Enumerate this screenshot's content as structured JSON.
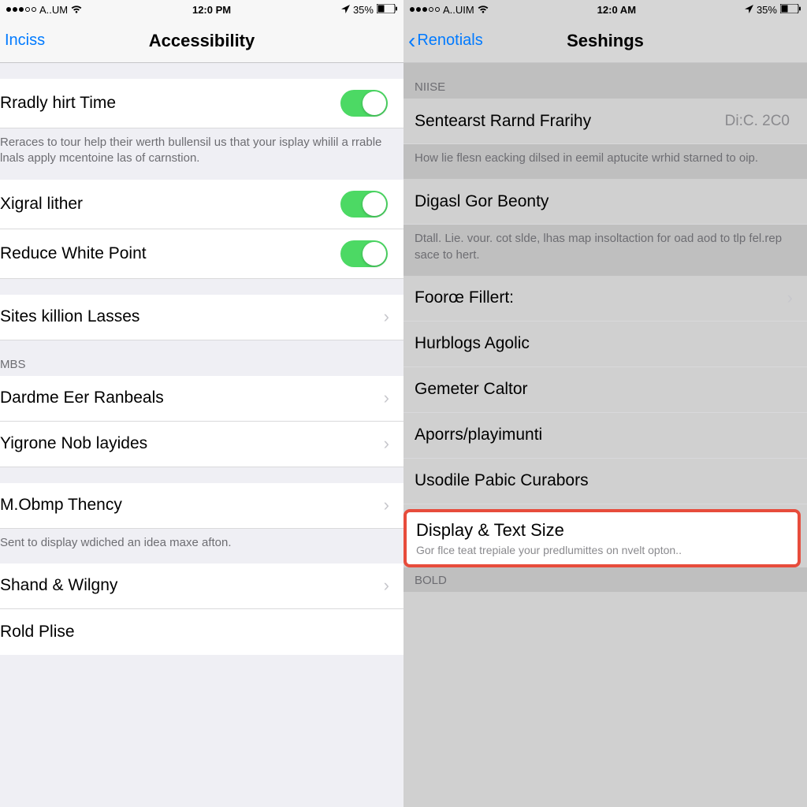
{
  "left": {
    "status": {
      "carrier": "A..UM",
      "time": "12:0 PM",
      "battery": "35%"
    },
    "nav": {
      "back": "Inciss",
      "title": "Accessibility"
    },
    "group1": {
      "toggle1": "Rradly hirt Time",
      "footer1": "Reraces to tour help their werth bullensil us that your isplay whilil a rrable lnals apply mcentoine las of carnstion."
    },
    "group2": {
      "toggle2": "Xigral lither",
      "toggle3": "Reduce White Point",
      "link1": "Sites killion Lasses"
    },
    "sectionHeader2": "MBS",
    "group3": {
      "link2": "Dardme Eer Ranbeals",
      "link3": "Yigrone Nob layides",
      "link4": "M.Obmp Thency",
      "footer2": "Sent to display wdiched an idea maxe afton."
    },
    "group4": {
      "link5": "Shand & Wilgny",
      "link6": "Rold Plise"
    }
  },
  "right": {
    "status": {
      "carrier": "A..UIM",
      "time": "12:0 AM",
      "battery": "35%"
    },
    "nav": {
      "back": "Renotials",
      "title": "Seshings"
    },
    "sectionHeader1": "NIISE",
    "group1": {
      "row1": {
        "label": "Sentearst Rarnd Frarihy",
        "detail": "Di:C.  2C0"
      },
      "footer1": "How lie flesn eacking dilsed in eemil aptucite wrhid starned to oip."
    },
    "group2": {
      "row2": "Digasl Gor Beonty",
      "footer2": "Dtall. Lie. vour. cot slde, lhas map insoltaction for oad aod to tlp fel.rep sace to hert."
    },
    "group3": {
      "row3": "Foorœ Fillert:",
      "row4": "Hurblogs Agolic",
      "row5": "Gemeter Caltor",
      "row6": "Aporrs/playimunti",
      "row7": "Usodile Pabic Curabors"
    },
    "highlight": {
      "label": "Display & Text Size",
      "sub": "Gor flce teat trepiale your predlumittes on nvelt opton.."
    },
    "bold": "BOLD"
  }
}
